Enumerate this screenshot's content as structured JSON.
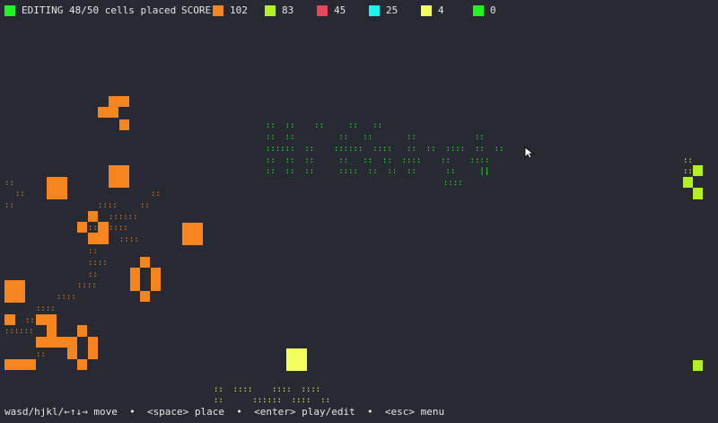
{
  "hud": {
    "mode": "EDITING",
    "placed": "48/50 cells placed",
    "score_label": "SCORE",
    "scores": [
      {
        "color": "#f5861f",
        "value": "102"
      },
      {
        "color": "#b3f024",
        "value": "83"
      },
      {
        "color": "#e8475a",
        "value": "45"
      },
      {
        "color": "#1ff5f0",
        "value": "25"
      },
      {
        "color": "#f2ff5c",
        "value": "4"
      },
      {
        "color": "#1ff51f",
        "value": "0"
      }
    ],
    "mode_color": "#1ff51f"
  },
  "footer": {
    "keys": "wasd/hjkl/←↑↓→ move  •  <space> place  •  <enter> play/edit  •  <esc> menu"
  },
  "board": {
    "palette": {
      "orange": "#f5861f",
      "lime": "#b3f024",
      "yellow": "#f2ff5c",
      "green": "#1ff51f",
      "green_dim": "#2dbb2d"
    }
  }
}
